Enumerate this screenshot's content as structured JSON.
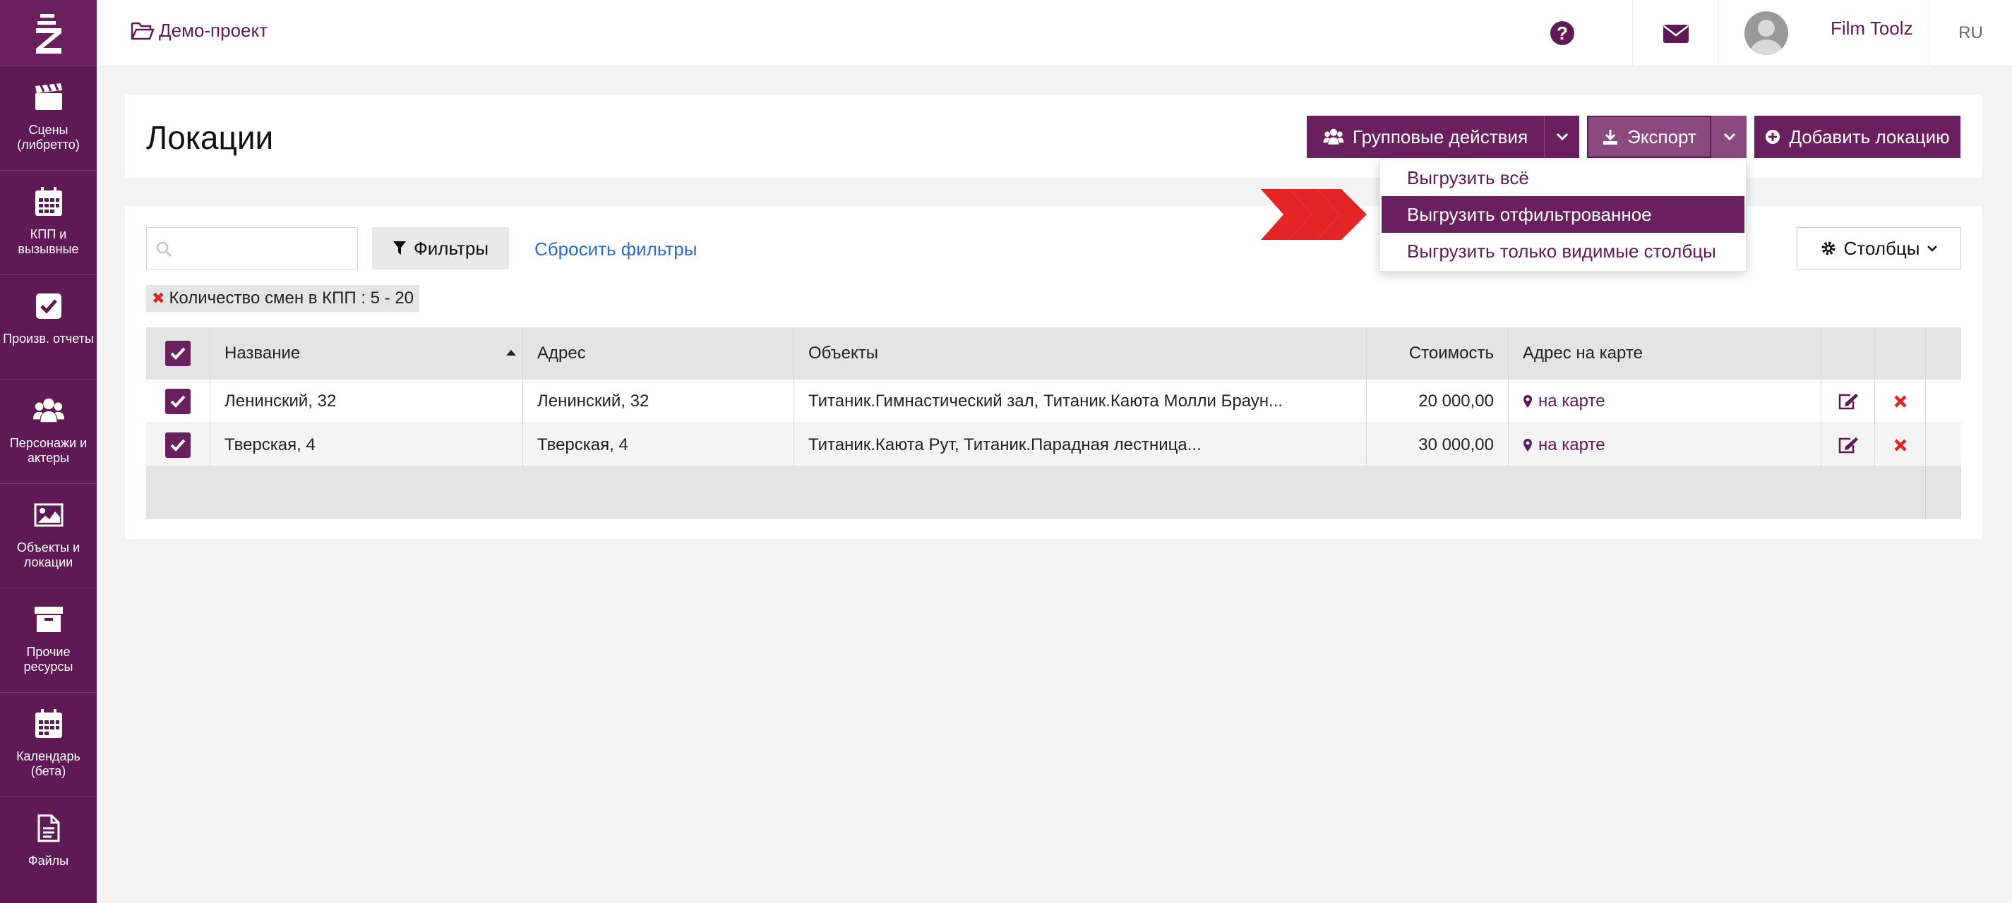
{
  "sidebar": {
    "items": [
      {
        "label": "Сцены\n(либретто)",
        "icon": "clapperboard-icon"
      },
      {
        "label": "КПП и\nвызывные",
        "icon": "calendar-grid-icon"
      },
      {
        "label": "Произв. отчеты",
        "icon": "check-square-icon"
      },
      {
        "label": "Персонажи и\nактеры",
        "icon": "users-icon"
      },
      {
        "label": "Объекты и\nлокации",
        "icon": "image-icon"
      },
      {
        "label": "Прочие\nресурсы",
        "icon": "archive-box-icon"
      },
      {
        "label": "Календарь\n(бета)",
        "icon": "calendar-icon"
      },
      {
        "label": "Файлы",
        "icon": "file-icon"
      }
    ]
  },
  "topbar": {
    "breadcrumb": "Демо-проект",
    "user_name": "Film Toolz",
    "language": "RU"
  },
  "header": {
    "title": "Локации",
    "group_actions_label": "Групповые действия",
    "export_label": "Экспорт",
    "add_location_label": "Добавить локацию"
  },
  "export_menu": {
    "items": [
      "Выгрузить всё",
      "Выгрузить отфильтрованное",
      "Выгрузить только видимые столбцы"
    ],
    "active_index": 1
  },
  "filters": {
    "search_placeholder": "",
    "filters_label": "Фильтры",
    "reset_label": "Сбросить фильтры",
    "columns_label": "Столбцы",
    "active_filter": "Количество смен в КПП :  5 - 20"
  },
  "table": {
    "columns": [
      "Название",
      "Адрес",
      "Объекты",
      "Стоимость",
      "Адрес на карте"
    ],
    "sorted_column": "Название",
    "rows": [
      {
        "name": "Ленинский, 32",
        "address": "Ленинский, 32",
        "objects": "Титаник.Гимнастический зал, Титаник.Каюта Молли Браун...",
        "cost": "20 000,00",
        "map": "на карте",
        "checked": true
      },
      {
        "name": "Тверская, 4",
        "address": "Тверская, 4",
        "objects": "Титаник.Каюта Рут, Титаник.Парадная лестница...",
        "cost": "30 000,00",
        "map": "на карте",
        "checked": true
      }
    ]
  },
  "colors": {
    "brand": "#6a1f5f",
    "sidebar": "#5f1a55",
    "link": "#2a6bd0",
    "delete": "#e02424",
    "arrow": "#e52525"
  }
}
